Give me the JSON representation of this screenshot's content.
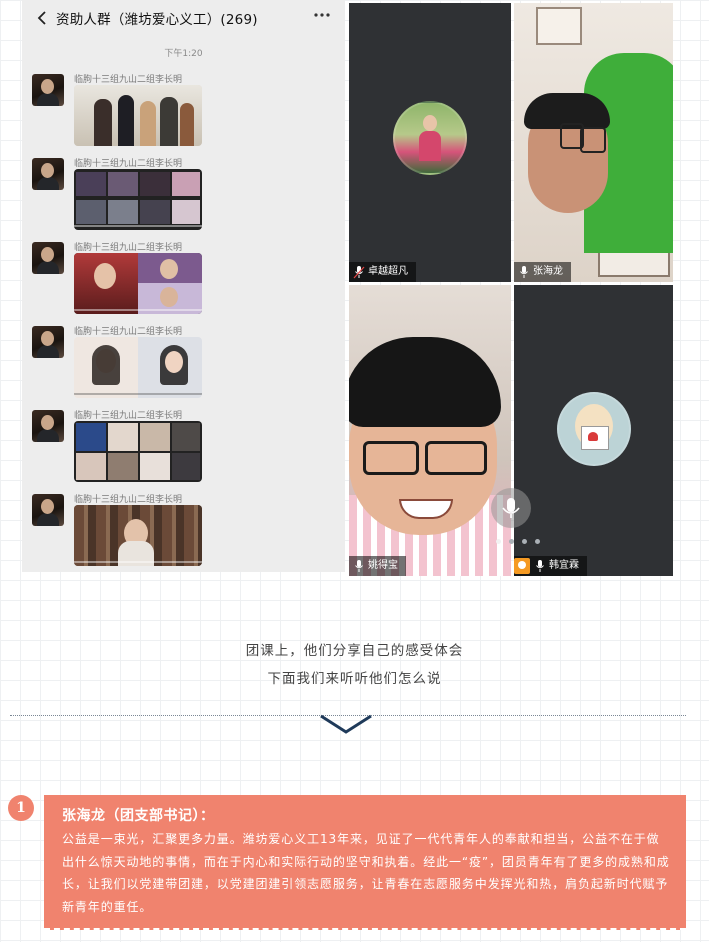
{
  "chat": {
    "back_icon": "chevron-left-icon",
    "title": "资助人群（潍坊爱心义工）(269)",
    "more_icon": "more-dots-icon",
    "time": "下午1:20",
    "messages": [
      {
        "sender": "临朐十三组九山二组李长明"
      },
      {
        "sender": "临朐十三组九山二组李长明"
      },
      {
        "sender": "临朐十三组九山二组李长明"
      },
      {
        "sender": "临朐十三组九山二组李长明"
      },
      {
        "sender": "临朐十三组九山二组李长明"
      },
      {
        "sender": "临朐十三组九山二组李长明"
      }
    ]
  },
  "video": {
    "participants": [
      {
        "name": "卓越超凡"
      },
      {
        "name": "张海龙"
      },
      {
        "name": "姚得宝"
      },
      {
        "name": "韩宜霖"
      }
    ],
    "page_dots": 4,
    "active_dot": 0
  },
  "caption": {
    "line1": "团课上，他们分享自己的感受体会",
    "line2": "下面我们来听听他们怎么说"
  },
  "section": {
    "number": "1",
    "title": "张海龙（团支部书记）：",
    "body": "公益是一束光，汇聚更多力量。潍坊爱心义工13年来，见证了一代代青年人的奉献和担当，公益不在于做出什么惊天动地的事情，而在于内心和实际行动的坚守和执着。经此一“疫”，团员青年有了更多的成熟和成长，让我们以党建带团建，以党建团建引领志愿服务，让青春在志愿服务中发挥光和热，肩负起新时代赋予新青年的重任。"
  },
  "colors": {
    "accent": "#f0836e",
    "chat_bg": "#ededed",
    "video_bg": "#2f3134",
    "divider_chevron": "#1f3a5a"
  }
}
